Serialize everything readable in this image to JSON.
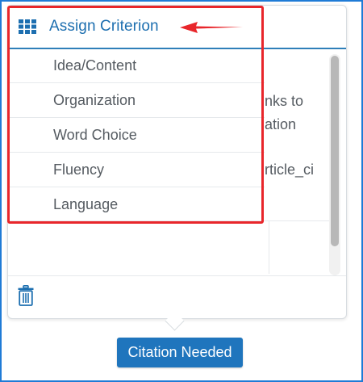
{
  "popup": {
    "title": "Assign Criterion",
    "criteria": [
      "Idea/Content",
      "Organization",
      "Word Choice",
      "Fluency",
      "Language"
    ],
    "behind_text": [
      "nks to",
      "ation",
      "rticle_ci"
    ]
  },
  "tag_button": {
    "label": "Citation Needed"
  },
  "colors": {
    "accent": "#1d6fb0",
    "button": "#1f75bd",
    "highlight": "#e8262b",
    "frame": "#1f7bd6"
  },
  "icons": [
    "grid-icon",
    "trash-icon"
  ]
}
